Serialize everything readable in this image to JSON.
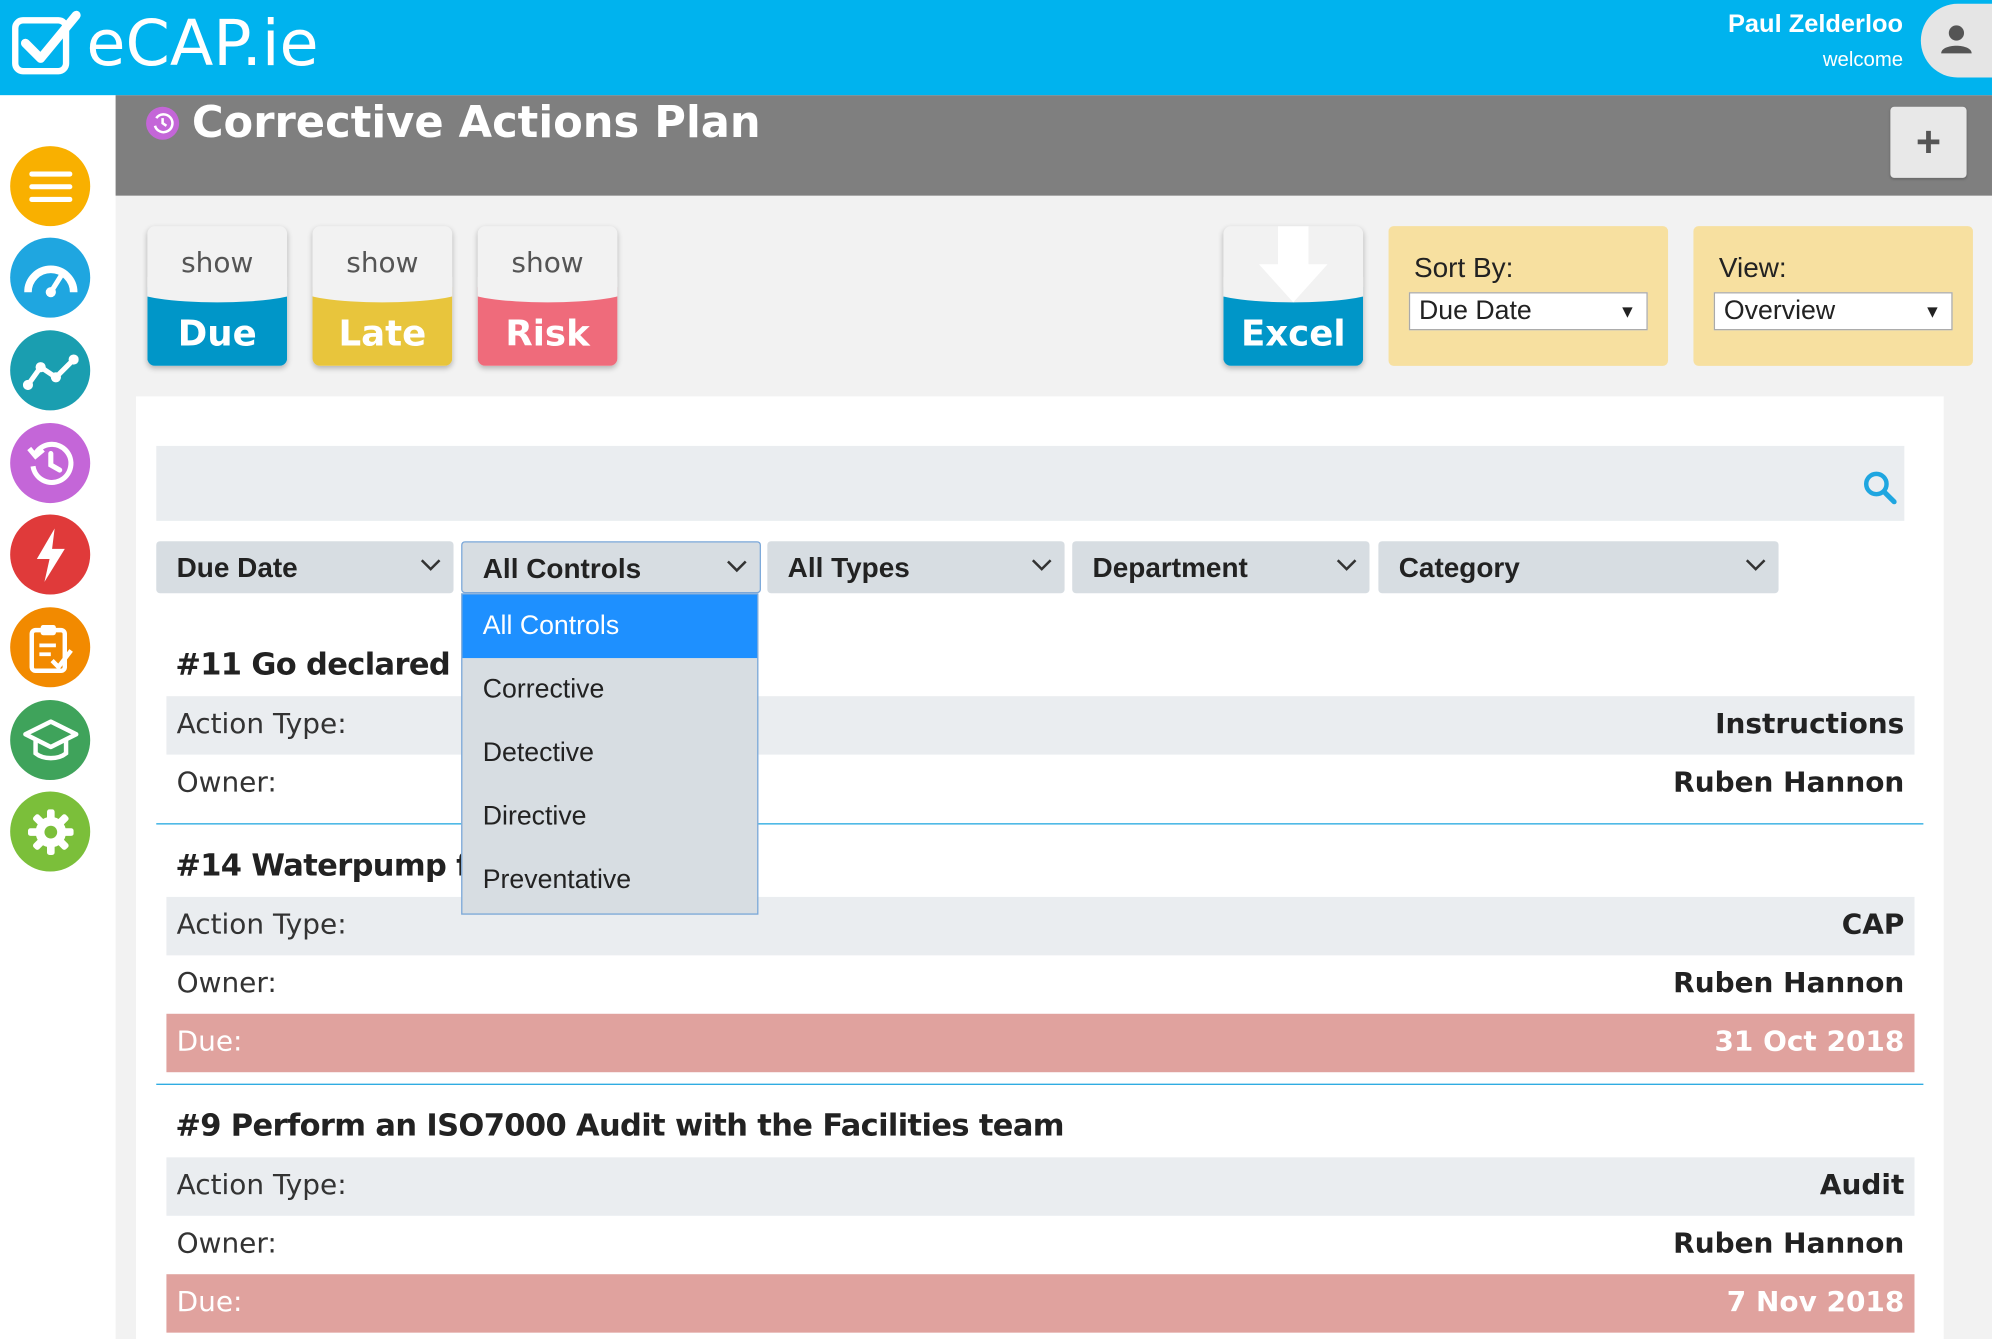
{
  "app": {
    "logo_text": "eCAP.ie"
  },
  "user": {
    "name": "Paul Zelderloo",
    "subtitle": "welcome"
  },
  "sidebar": {
    "items": [
      {
        "name": "menu",
        "color": "#f9b000"
      },
      {
        "name": "dashboard",
        "color": "#1fa6e0"
      },
      {
        "name": "analytics",
        "color": "#1a9eb0"
      },
      {
        "name": "corrective-actions",
        "color": "#c466d8"
      },
      {
        "name": "incidents",
        "color": "#e03a3a"
      },
      {
        "name": "audits",
        "color": "#f28a00"
      },
      {
        "name": "training",
        "color": "#3fa35b"
      },
      {
        "name": "settings",
        "color": "#7bbf3a"
      }
    ]
  },
  "header": {
    "title": "Corrective Actions Plan",
    "add_label": "+"
  },
  "toolbar": {
    "tiles": [
      {
        "top": "show",
        "bottom": "Due",
        "color": "#0096c8"
      },
      {
        "top": "show",
        "bottom": "Late",
        "color": "#e8c53c"
      },
      {
        "top": "show",
        "bottom": "Risk",
        "color": "#ef6b7b"
      }
    ],
    "excel_label": "Excel",
    "sort_by": {
      "label": "Sort By:",
      "value": "Due Date"
    },
    "view": {
      "label": "View:",
      "value": "Overview"
    }
  },
  "search": {
    "placeholder": ""
  },
  "filters": [
    {
      "label": "Due Date"
    },
    {
      "label": "All Controls"
    },
    {
      "label": "All Types"
    },
    {
      "label": "Department"
    },
    {
      "label": "Category"
    }
  ],
  "dropdown": {
    "options": [
      "All Controls",
      "Corrective",
      "Detective",
      "Directive",
      "Preventative"
    ],
    "selected": "All Controls"
  },
  "items": [
    {
      "title": "#11 Go declared ger",
      "action_type_label": "Action Type:",
      "action_type": "Instructions",
      "owner_label": "Owner:",
      "owner": "Ruben Hannon"
    },
    {
      "title": "#14 Waterpump filt",
      "action_type_label": "Action Type:",
      "action_type": "CAP",
      "owner_label": "Owner:",
      "owner": "Ruben Hannon",
      "due_label": "Due:",
      "due": "31 Oct 2018"
    },
    {
      "title": "#9 Perform an ISO7000 Audit with the Facilities team",
      "action_type_label": "Action Type:",
      "action_type": "Audit",
      "owner_label": "Owner:",
      "owner": "Ruben Hannon",
      "due_label": "Due:",
      "due": "7 Nov 2018"
    }
  ],
  "colors": {
    "brand": "#00b3ee",
    "due_row": "#e0a29e",
    "header_band": "#7f7f7f"
  }
}
